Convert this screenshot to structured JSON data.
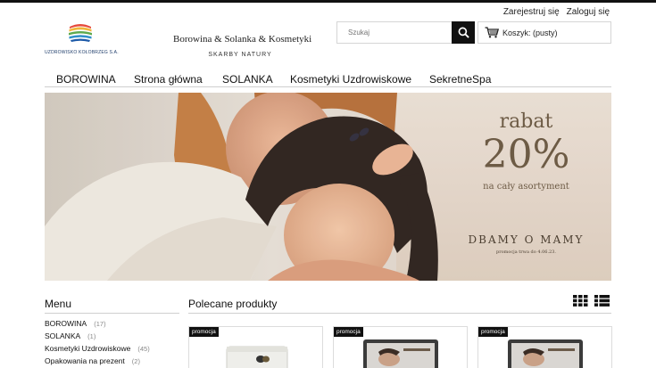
{
  "account": {
    "register": "Zarejestruj się",
    "login": "Zaloguj się"
  },
  "logo": {
    "text": "UZDROWISKO KOŁOBRZEG S.A."
  },
  "brand": {
    "title": "Borowina & Solanka & Kosmetyki",
    "subtitle": "SKARBY NATURY"
  },
  "search": {
    "placeholder": "Szukaj"
  },
  "cart": {
    "label": "Koszyk: (pusty)"
  },
  "nav": [
    "BOROWINA",
    "Strona główna",
    "SOLANKA",
    "Kosmetyki Uzdrowiskowe",
    "SekretneSpa"
  ],
  "banner": {
    "rabat": "rabat",
    "percent": "20%",
    "sub": "na cały asortyment",
    "headline": "DBAMY O MAMY",
    "note": "promocja trwa do 4.06.23."
  },
  "menu": {
    "title": "Menu",
    "items": [
      {
        "label": "BOROWINA",
        "count": "(17)"
      },
      {
        "label": "SOLANKA",
        "count": "(1)"
      },
      {
        "label": "Kosmetyki Uzdrowiskowe",
        "count": "(45)"
      },
      {
        "label": "Opakowania na prezent",
        "count": "(2)"
      }
    ]
  },
  "featured": {
    "title": "Polecane produkty",
    "badge": "promocja"
  },
  "colors": {
    "accent": "#111111",
    "banner_text": "#6d5b45",
    "cart_icon": "#222222"
  }
}
